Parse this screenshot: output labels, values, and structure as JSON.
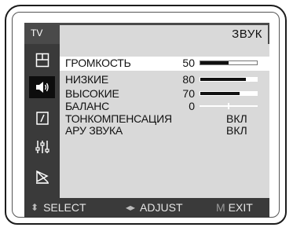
{
  "source": "TV",
  "title": "ЗВУК",
  "sidebar": {
    "items": [
      {
        "icon": "picture-icon",
        "active": false
      },
      {
        "icon": "sound-icon",
        "active": true
      },
      {
        "icon": "timer-icon",
        "active": false
      },
      {
        "icon": "setup-icon",
        "active": false
      },
      {
        "icon": "function-icon",
        "active": false
      }
    ]
  },
  "menu": {
    "rows": [
      {
        "label": "ГРОМКОСТЬ",
        "value": "50",
        "level_percent": 50,
        "selected": true
      },
      {
        "label": "НИЗКИЕ",
        "value": "80",
        "level_percent": 80
      },
      {
        "label": "ВЫСОКИЕ",
        "value": "70",
        "level_percent": 70
      },
      {
        "label": "БАЛАНС",
        "value": "0",
        "balance_position": 0
      },
      {
        "label": "ТОНКОМПЕНСАЦИЯ",
        "value": "ВКЛ"
      },
      {
        "label": "АРУ ЗВУКА",
        "value": "ВКЛ"
      }
    ]
  },
  "footer": {
    "select_glyph": "⬍",
    "select_label": "SELECT",
    "adjust_glyph": "◂▸",
    "adjust_label": "ADJUST",
    "exit_glyph": "M",
    "exit_label": "EXIT"
  },
  "colors": {
    "panel": "#d9d9d9",
    "sidebar": "#3a3a3a",
    "selected_row": "#ffffff",
    "text": "#111111"
  }
}
